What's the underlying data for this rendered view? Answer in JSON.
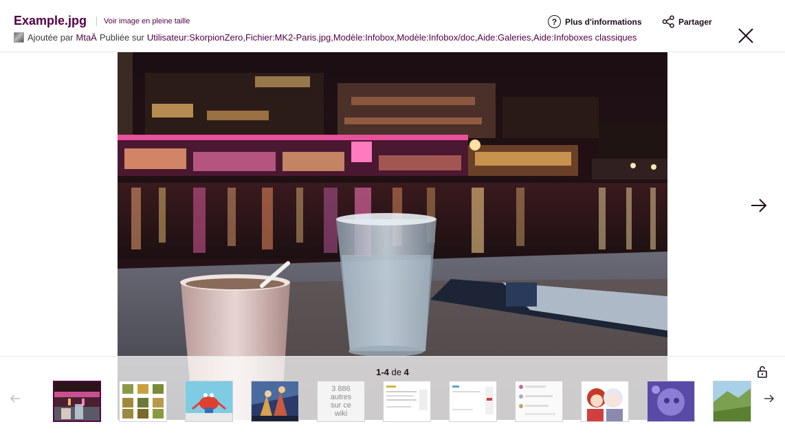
{
  "header": {
    "title": "Example.jpg",
    "full_size_link": "Voir image en pleine taille",
    "added_by_prefix": "Ajoutée par",
    "added_by_user": "MtaÄ",
    "published_on_prefix": "Publiée sur",
    "published_on_pages": "Utilisateur:SkorpionZero,Fichier:MK2-Paris.jpg,Modèle:Infobox,Modèle:Infobox/doc,Aide:Galeries,Aide:Infoboxes classiques",
    "more_info_label": "Plus d'informations",
    "share_label": "Partager"
  },
  "filmstrip": {
    "counter_range": "1-4",
    "counter_of": "de",
    "counter_total": "4",
    "more_images_text": "3 886\nautres\nsur ce\nwiki"
  },
  "colors": {
    "brand": "#520044",
    "text_dark": "#1e0c1b"
  },
  "icons": {
    "info": "question-circle-icon",
    "share": "share-nodes-icon",
    "close": "close-icon",
    "next": "arrow-right-icon",
    "prev": "arrow-left-icon",
    "lock": "padlock-open-icon"
  }
}
